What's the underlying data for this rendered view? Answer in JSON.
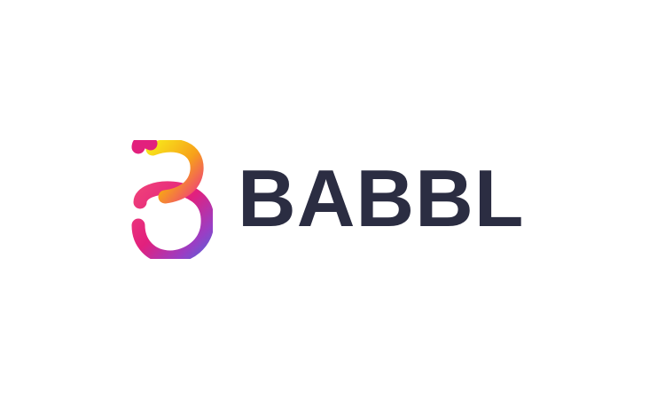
{
  "brand": {
    "name": "BABBL",
    "text_color": "#2b2d42"
  },
  "logo": {
    "icon": "babbl-b-gradient-icon",
    "gradient_colors": [
      "#f7e31a",
      "#f7a11a",
      "#ef3f7a",
      "#e2207d",
      "#9a3ec4",
      "#2f8fdc",
      "#22c7c7"
    ]
  }
}
